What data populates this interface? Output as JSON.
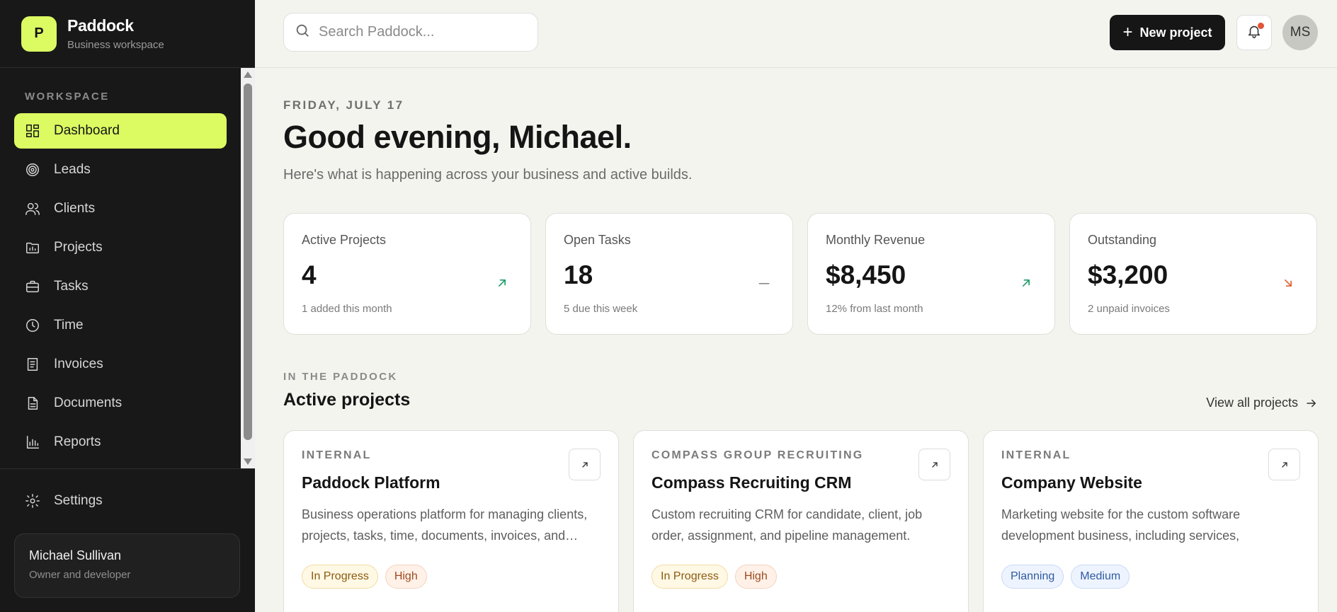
{
  "brand": {
    "logo_letter": "P",
    "name": "Paddock",
    "subtitle": "Business workspace"
  },
  "sidebar": {
    "section_label": "WORKSPACE",
    "items": [
      {
        "label": "Dashboard",
        "icon": "dashboard-icon",
        "active": true
      },
      {
        "label": "Leads",
        "icon": "target-icon"
      },
      {
        "label": "Clients",
        "icon": "users-icon"
      },
      {
        "label": "Projects",
        "icon": "folder-icon"
      },
      {
        "label": "Tasks",
        "icon": "briefcase-icon"
      },
      {
        "label": "Time",
        "icon": "clock-icon"
      },
      {
        "label": "Invoices",
        "icon": "receipt-icon"
      },
      {
        "label": "Documents",
        "icon": "document-icon"
      },
      {
        "label": "Reports",
        "icon": "bar-chart-icon"
      }
    ],
    "settings_label": "Settings",
    "user": {
      "name": "Michael Sullivan",
      "role": "Owner and developer"
    }
  },
  "topbar": {
    "search_placeholder": "Search Paddock...",
    "new_project_label": "New project",
    "avatar_initials": "MS"
  },
  "header": {
    "date": "FRIDAY, JULY 17",
    "greeting": "Good evening, Michael.",
    "subtext": "Here's what is happening across your business and active builds."
  },
  "stats": [
    {
      "label": "Active Projects",
      "value": "4",
      "note": "1 added this month",
      "trend": "up",
      "trend_color": "#1f9d6b"
    },
    {
      "label": "Open Tasks",
      "value": "18",
      "note": "5 due this week",
      "trend": "flat",
      "trend_color": "#8a8a8a"
    },
    {
      "label": "Monthly Revenue",
      "value": "$8,450",
      "note": "12% from last month",
      "trend": "up",
      "trend_color": "#1f9d6b"
    },
    {
      "label": "Outstanding",
      "value": "$3,200",
      "note": "2 unpaid invoices",
      "trend": "down",
      "trend_color": "#e0622f"
    }
  ],
  "projects_section": {
    "eyebrow": "IN THE PADDOCK",
    "title": "Active projects",
    "view_all_label": "View all projects"
  },
  "projects": [
    {
      "client": "INTERNAL",
      "name": "Paddock Platform",
      "description": "Business operations platform for managing clients, projects, tasks, time, documents, invoices, and…",
      "tags": [
        {
          "label": "In Progress",
          "kind": "inprogress"
        },
        {
          "label": "High",
          "kind": "high"
        }
      ]
    },
    {
      "client": "COMPASS GROUP RECRUITING",
      "name": "Compass Recruiting CRM",
      "description": "Custom recruiting CRM for candidate, client, job order, assignment, and pipeline management.",
      "tags": [
        {
          "label": "In Progress",
          "kind": "inprogress"
        },
        {
          "label": "High",
          "kind": "high"
        }
      ]
    },
    {
      "client": "INTERNAL",
      "name": "Company Website",
      "description": "Marketing website for the custom software development business, including services, projects,…",
      "tags": [
        {
          "label": "Planning",
          "kind": "planning"
        },
        {
          "label": "Medium",
          "kind": "medium"
        }
      ]
    }
  ]
}
